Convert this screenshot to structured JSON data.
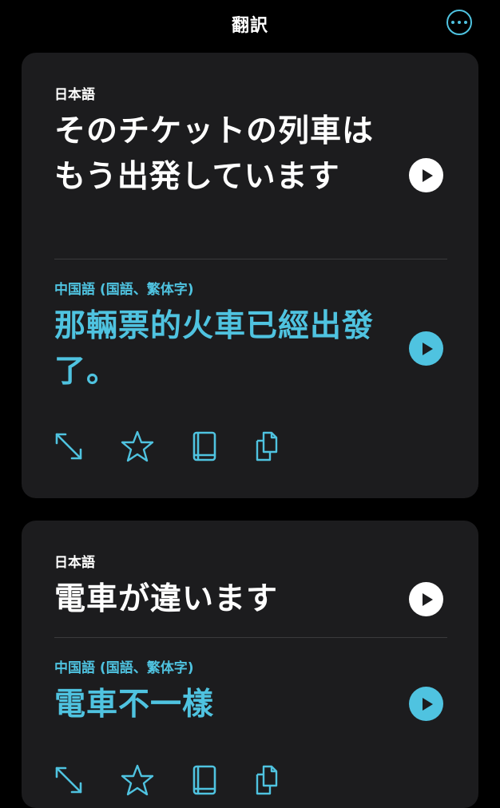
{
  "header": {
    "title": "翻訳",
    "more_icon": "ellipsis-circle-icon"
  },
  "colors": {
    "background": "#000000",
    "card": "#1c1c1e",
    "accent": "#4fc3e0",
    "text": "#ffffff",
    "divider": "#3a3a3c"
  },
  "cards": [
    {
      "source_language": "日本語",
      "source_text": "そのチケットの列車はもう出発しています",
      "target_language": "中国語 (国語、繁体字)",
      "target_text": "那輛票的火車已經出發了。"
    },
    {
      "source_language": "日本語",
      "source_text": "電車が違います",
      "target_language": "中国語 (国語、繁体字)",
      "target_text": "電車不一樣"
    }
  ],
  "actions": {
    "expand_icon": "expand-arrows-icon",
    "favorite_icon": "star-icon",
    "dictionary_icon": "book-icon",
    "copy_icon": "copy-icon"
  }
}
